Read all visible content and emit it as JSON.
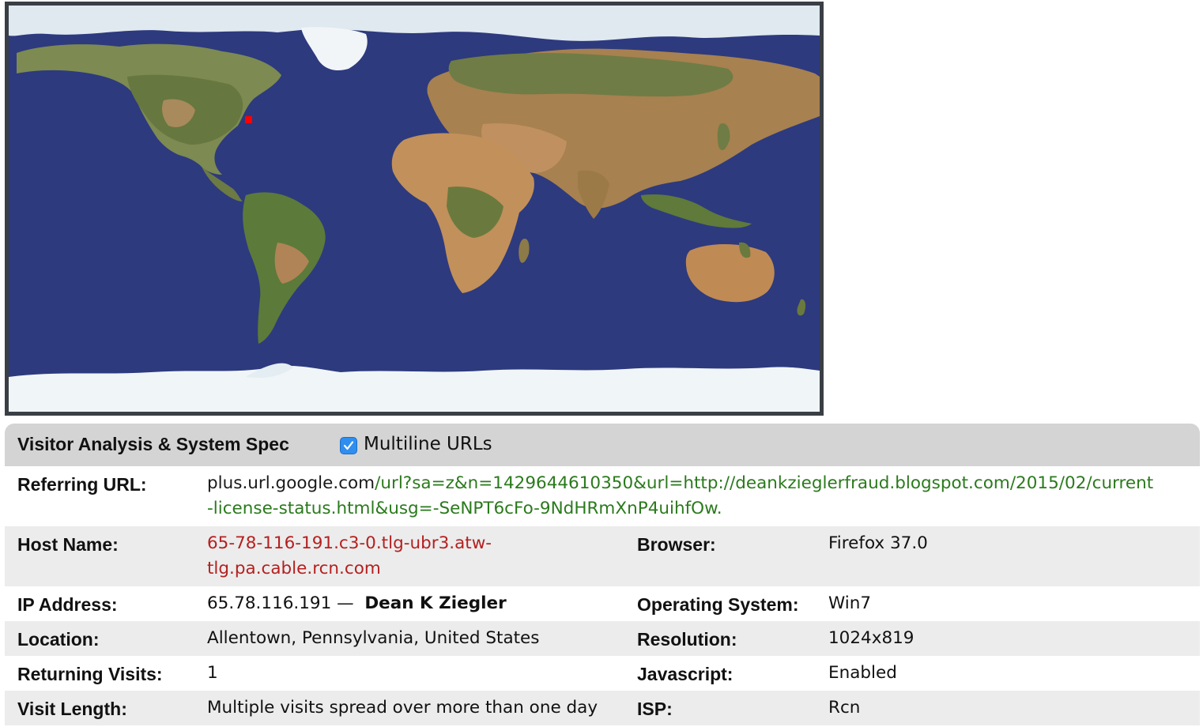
{
  "map": {
    "marker_color": "#ff0000",
    "ocean_color": "#2d3a7e",
    "land_color": "#b08456",
    "ice_color": "#e8f0f4"
  },
  "panel": {
    "title": "Visitor Analysis & System Spec",
    "multiline_urls_label": "Multiline URLs",
    "multiline_urls_checked": true
  },
  "referring_url": {
    "label": "Referring URL:",
    "host": "plus.url.google.com",
    "path_line1": "/url?sa=z&n=1429644610350&url=http://deankzieglerfraud.blogspot.com/2015/02/current",
    "path_line2": "-license-status.html&usg=-SeNPT6cFo-9NdHRmXnP4uihfOw."
  },
  "host_name": {
    "label": "Host Name:",
    "line1": "65-78-116-191.c3-0.tlg-ubr3.atw-",
    "line2": "tlg.pa.cable.rcn.com"
  },
  "browser": {
    "label": "Browser:",
    "value": "Firefox 37.0"
  },
  "ip_address": {
    "label": "IP Address:",
    "value": "65.78.116.191",
    "separator": "—",
    "owner": "Dean K Ziegler"
  },
  "operating_system": {
    "label": "Operating System:",
    "value": "Win7"
  },
  "location": {
    "label": "Location:",
    "value": "Allentown, Pennsylvania, United States"
  },
  "resolution": {
    "label": "Resolution:",
    "value": "1024x819"
  },
  "returning_visits": {
    "label": "Returning Visits:",
    "value": "1"
  },
  "javascript": {
    "label": "Javascript:",
    "value": "Enabled"
  },
  "visit_length": {
    "label": "Visit Length:",
    "value": "Multiple visits spread over more than one day"
  },
  "isp": {
    "label": "ISP:",
    "value": "Rcn"
  }
}
